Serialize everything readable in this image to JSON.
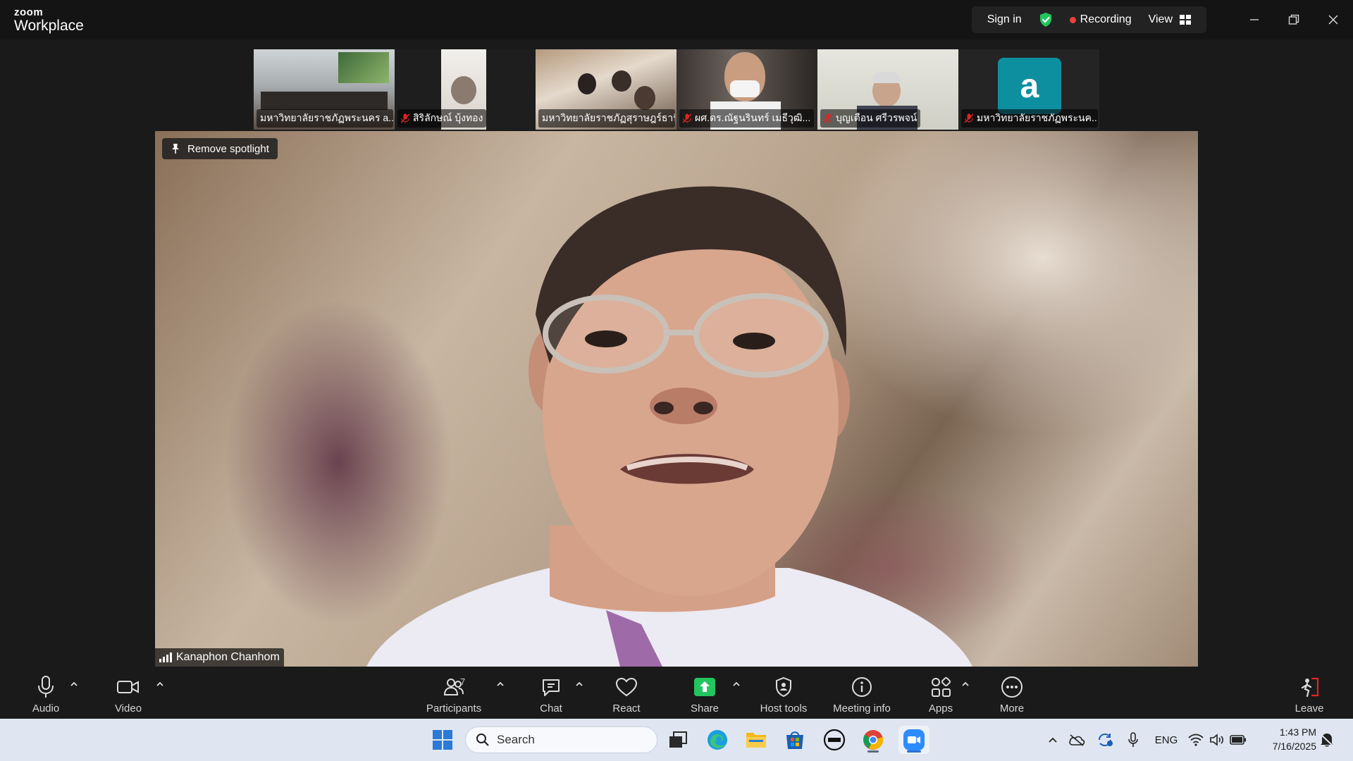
{
  "app": {
    "brand_small": "zoom",
    "brand_large": "Workplace"
  },
  "header": {
    "sign_in": "Sign in",
    "recording": "Recording",
    "view": "View"
  },
  "gallery": [
    {
      "name": "มหาวิทยาลัยราชภัฏพระนคร a...",
      "muted": false
    },
    {
      "name": "สิริลักษณ์ บุ้งทอง",
      "muted": true
    },
    {
      "name": "มหาวิทยาลัยราชภัฏสุราษฎร์ธานี",
      "muted": false
    },
    {
      "name": "ผศ.ดร.ณัฐนรินทร์ เมธีวุฒิ...",
      "muted": true
    },
    {
      "name": "บุญเตือน ศรีวรพจน์",
      "muted": true
    },
    {
      "name": "มหาวิทยาลัยราชภัฏพระนค...",
      "muted": true,
      "avatar_letter": "a"
    }
  ],
  "main": {
    "spotlight_button": "Remove spotlight",
    "speaker_name": "Kanaphon Chanhom"
  },
  "toolbar": {
    "audio": "Audio",
    "video": "Video",
    "participants": "Participants",
    "participants_count": "7",
    "chat": "Chat",
    "react": "React",
    "share": "Share",
    "host_tools": "Host tools",
    "meeting_info": "Meeting info",
    "apps": "Apps",
    "more": "More",
    "leave": "Leave"
  },
  "taskbar": {
    "search_placeholder": "Search",
    "language": "ENG",
    "time": "1:43 PM",
    "date": "7/16/2025"
  },
  "colors": {
    "recording": "#e8423a",
    "share_green": "#22c55e",
    "shield_green": "#22c55e",
    "leave_red": "#e02424",
    "avatar_teal": "#0e8fa0"
  }
}
